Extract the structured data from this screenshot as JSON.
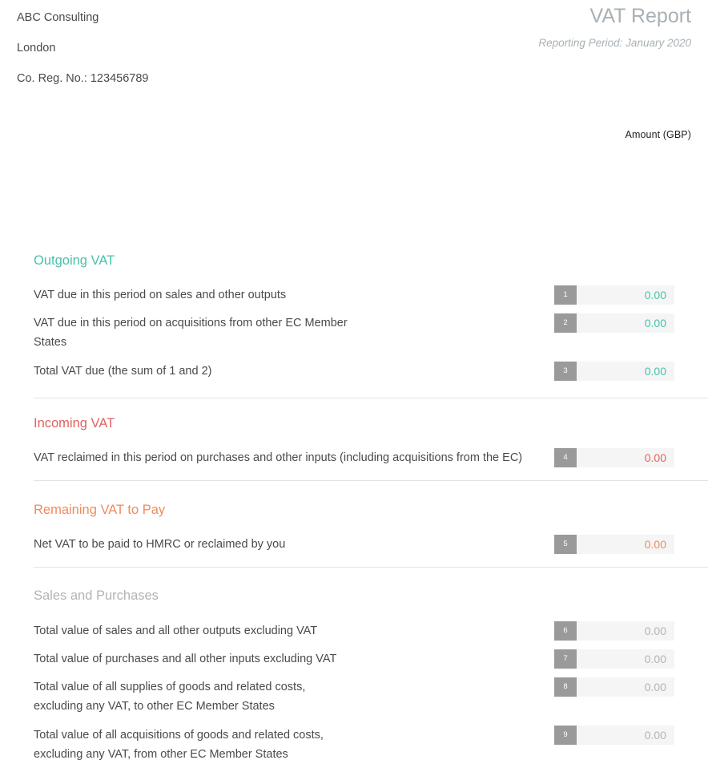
{
  "header": {
    "company_name": "ABC Consulting",
    "company_city": "London",
    "company_reg": "Co. Reg. No.: 123456789",
    "doc_title": "VAT Report",
    "reporting_period": "Reporting Period: January 2020"
  },
  "table": {
    "amount_column_header": "Amount (GBP)"
  },
  "colors": {
    "outgoing": "#4ac1a8",
    "incoming": "#e06161",
    "remaining": "#f08a5d",
    "sales": "#b0b4b8",
    "index_badge": "#9a9a9a",
    "field_background": "#f5f5f5",
    "divider": "#e3e3e3"
  },
  "sections": [
    {
      "id": "outgoing",
      "title": "Outgoing VAT",
      "rows": [
        {
          "index": "1",
          "label": "VAT due in this period on sales and other outputs",
          "amount": "0.00"
        },
        {
          "index": "2",
          "label": "VAT due in this period on acquisitions from other EC Member\nStates",
          "amount": "0.00"
        },
        {
          "index": "3",
          "label": "Total VAT due (the sum of 1 and 2)",
          "amount": "0.00"
        }
      ]
    },
    {
      "id": "incoming",
      "title": "Incoming VAT",
      "rows": [
        {
          "index": "4",
          "label": "VAT reclaimed in this period on purchases and other inputs (including acquisitions from the EC)",
          "amount": "0.00"
        }
      ]
    },
    {
      "id": "remaining",
      "title": "Remaining VAT to Pay",
      "rows": [
        {
          "index": "5",
          "label": "Net VAT to be paid to HMRC or reclaimed by you",
          "amount": "0.00"
        }
      ]
    },
    {
      "id": "sales",
      "title": "Sales and Purchases",
      "rows": [
        {
          "index": "6",
          "label": "Total value of sales and all other outputs excluding VAT",
          "amount": "0.00"
        },
        {
          "index": "7",
          "label": "Total value of purchases and all other inputs excluding VAT",
          "amount": "0.00"
        },
        {
          "index": "8",
          "label": "Total value of all supplies of goods and related costs,\nexcluding any VAT, to other EC Member States",
          "amount": "0.00"
        },
        {
          "index": "9",
          "label": "Total value of all acquisitions of goods and related costs,\nexcluding any VAT, from other EC Member States",
          "amount": "0.00"
        }
      ]
    }
  ]
}
